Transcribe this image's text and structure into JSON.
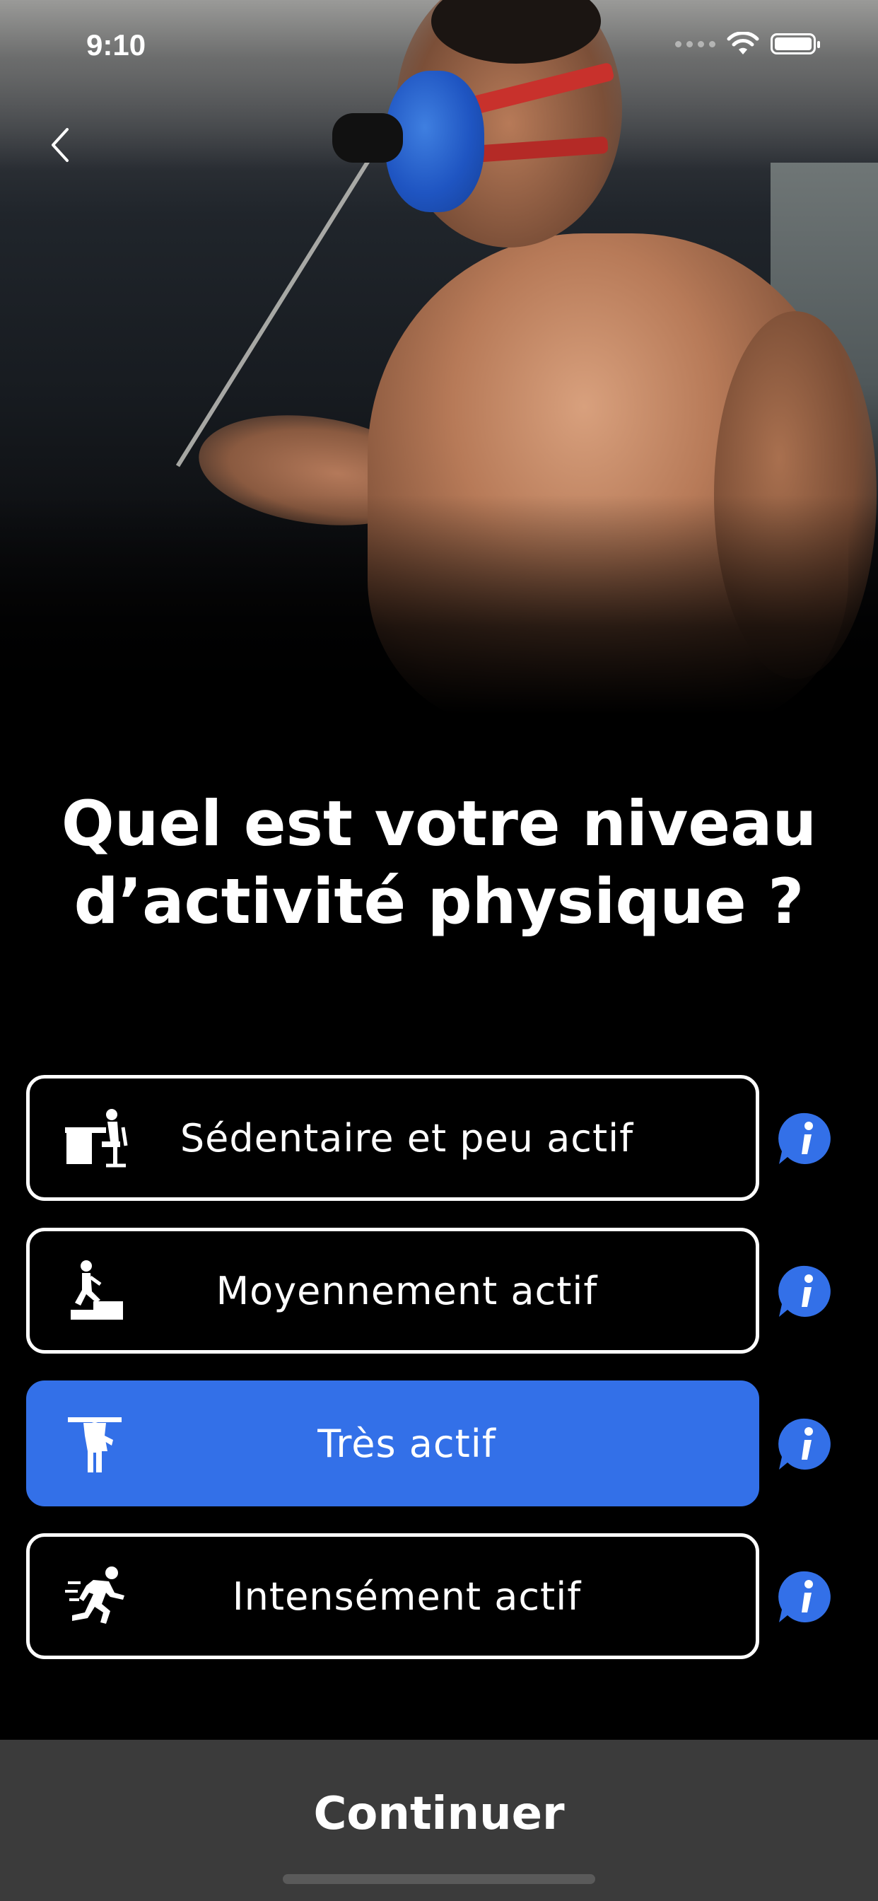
{
  "status_bar": {
    "time": "9:10"
  },
  "header": {
    "back_icon": "chevron-left-icon"
  },
  "title": {
    "line1": "Quel est votre niveau",
    "line2": "d’activité physique ?"
  },
  "options": [
    {
      "label": "Sédentaire et peu actif",
      "icon": "desk-sitting-icon",
      "selected": false
    },
    {
      "label": "Moyennement actif",
      "icon": "stairs-walking-icon",
      "selected": false
    },
    {
      "label": "Très actif",
      "icon": "person-lifting-icon",
      "selected": true
    },
    {
      "label": "Intensément actif",
      "icon": "running-icon",
      "selected": false
    }
  ],
  "info_icon": "info-bubble-icon",
  "footer": {
    "continue_label": "Continuer"
  },
  "colors": {
    "accent": "#3370e8",
    "background": "#000000",
    "footer_bg": "#3b3b3b"
  }
}
